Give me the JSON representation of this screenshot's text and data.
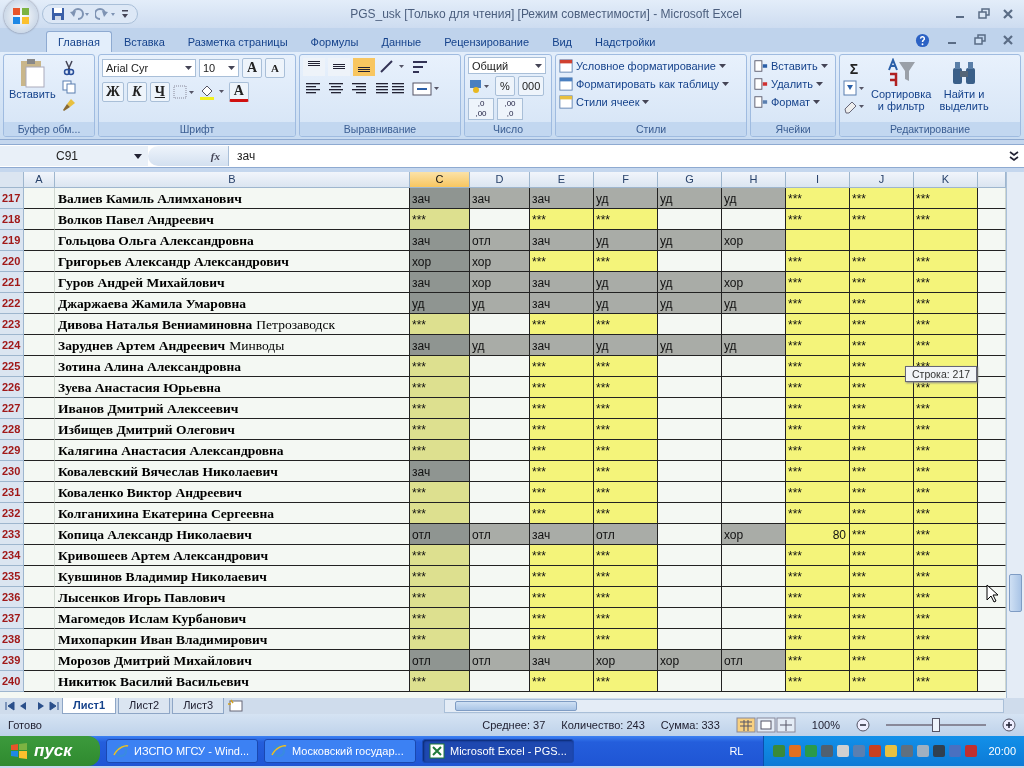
{
  "window": {
    "title": "PGS_usk  [Только для чтения]  [Режим совместимости] - Microsoft Excel"
  },
  "tabs": [
    {
      "label": "Главная",
      "selected": true
    },
    {
      "label": "Вставка",
      "selected": false
    },
    {
      "label": "Разметка страницы",
      "selected": false
    },
    {
      "label": "Формулы",
      "selected": false
    },
    {
      "label": "Данные",
      "selected": false
    },
    {
      "label": "Рецензирование",
      "selected": false
    },
    {
      "label": "Вид",
      "selected": false
    },
    {
      "label": "Надстройки",
      "selected": false
    }
  ],
  "ribbon": {
    "clipboard": {
      "paste": "Вставить",
      "label": "Буфер обм..."
    },
    "font": {
      "family": "Arial Cyr",
      "size": "10",
      "grow": "A",
      "shrink": "A",
      "bold": "Ж",
      "italic": "К",
      "underline": "Ч",
      "color_letter": "А",
      "label": "Шрифт"
    },
    "alignment": {
      "vertical": [
        {
          "selected": false
        },
        {
          "selected": false
        },
        {
          "selected": true
        }
      ],
      "label": "Выравнивание"
    },
    "number": {
      "format": "Общий",
      "percent": "%",
      "thousands": "000",
      "decimals": [
        {
          "top": ",0",
          "bottom": ",00"
        },
        {
          "top": ",00",
          "bottom": ",0"
        }
      ],
      "label": "Число"
    },
    "styles": {
      "items": [
        "Условное форматирование",
        "Форматировать как таблицу",
        "Стили ячеек"
      ],
      "label": "Стили"
    },
    "cells": {
      "items": [
        "Вставить",
        "Удалить",
        "Формат"
      ],
      "label": "Ячейки"
    },
    "editing": {
      "sigma": "Σ",
      "sort": [
        "Сортировка",
        "и фильтр"
      ],
      "find": [
        "Найти и",
        "выделить"
      ],
      "label": "Редактирование"
    }
  },
  "formula_bar": {
    "name_box": "C91",
    "fx": "fx",
    "value": "зач"
  },
  "columns": [
    {
      "label": "A",
      "selected": false
    },
    {
      "label": "B",
      "selected": false
    },
    {
      "label": "C",
      "selected": true,
      "shaded": true
    },
    {
      "label": "D",
      "selected": false,
      "shaded": false
    },
    {
      "label": "E",
      "selected": false,
      "shaded": true
    },
    {
      "label": "F",
      "selected": false,
      "shaded": true
    },
    {
      "label": "G",
      "selected": false,
      "shaded": false
    },
    {
      "label": "H",
      "selected": false,
      "shaded": false
    },
    {
      "label": "I",
      "selected": false,
      "shaded": true
    },
    {
      "label": "J",
      "selected": false,
      "shaded": true
    },
    {
      "label": "K",
      "selected": false,
      "shaded": true
    }
  ],
  "rows": [
    {
      "number": "217",
      "name": "Валиев Камиль Алимханович",
      "cells": [
        {
          "text": "зач",
          "graded": true
        },
        {
          "text": "зач",
          "graded": true
        },
        {
          "text": "зач",
          "graded": true
        },
        {
          "text": "уд",
          "graded": true
        },
        {
          "text": "уд",
          "graded": true
        },
        {
          "text": "уд",
          "graded": true
        },
        {
          "text": "***",
          "graded": false
        },
        {
          "text": "***",
          "graded": false
        },
        {
          "text": "***",
          "graded": false
        }
      ]
    },
    {
      "number": "218",
      "name": "Волков Павел Андреевич",
      "cells": [
        {
          "text": "***",
          "graded": false
        },
        {
          "text": "",
          "graded": false
        },
        {
          "text": "***",
          "graded": false
        },
        {
          "text": "***",
          "graded": false
        },
        {
          "text": "",
          "graded": false
        },
        {
          "text": "",
          "graded": false
        },
        {
          "text": "***",
          "graded": false
        },
        {
          "text": "***",
          "graded": false
        },
        {
          "text": "***",
          "graded": false
        }
      ]
    },
    {
      "number": "219",
      "name": "Гольцова Ольга Александровна",
      "cells": [
        {
          "text": "зач",
          "graded": true
        },
        {
          "text": "отл",
          "graded": true
        },
        {
          "text": "зач",
          "graded": true
        },
        {
          "text": "уд",
          "graded": true
        },
        {
          "text": "уд",
          "graded": true
        },
        {
          "text": "хор",
          "graded": true
        },
        {
          "text": "",
          "graded": false
        },
        {
          "text": "",
          "graded": false
        },
        {
          "text": "",
          "graded": false
        }
      ]
    },
    {
      "number": "220",
      "name": "Григорьев Александр Александрович",
      "cells": [
        {
          "text": "хор",
          "graded": true
        },
        {
          "text": "хор",
          "graded": true
        },
        {
          "text": "***",
          "graded": false
        },
        {
          "text": "***",
          "graded": false
        },
        {
          "text": "",
          "graded": false
        },
        {
          "text": "",
          "graded": false
        },
        {
          "text": "***",
          "graded": false
        },
        {
          "text": "***",
          "graded": false
        },
        {
          "text": "***",
          "graded": false
        }
      ]
    },
    {
      "number": "221",
      "name": "Гуров Андрей Михайлович",
      "cells": [
        {
          "text": "зач",
          "graded": true
        },
        {
          "text": "хор",
          "graded": true
        },
        {
          "text": "зач",
          "graded": true
        },
        {
          "text": "уд",
          "graded": true
        },
        {
          "text": "уд",
          "graded": true
        },
        {
          "text": "хор",
          "graded": true
        },
        {
          "text": "***",
          "graded": false
        },
        {
          "text": "***",
          "graded": false
        },
        {
          "text": "***",
          "graded": false
        }
      ]
    },
    {
      "number": "222",
      "name": "Джаржаева Жамила Умаровна",
      "cells": [
        {
          "text": "уд",
          "graded": true
        },
        {
          "text": "уд",
          "graded": true
        },
        {
          "text": "зач",
          "graded": true
        },
        {
          "text": "уд",
          "graded": true
        },
        {
          "text": "уд",
          "graded": true
        },
        {
          "text": "уд",
          "graded": true
        },
        {
          "text": "***",
          "graded": false
        },
        {
          "text": "***",
          "graded": false
        },
        {
          "text": "***",
          "graded": false
        }
      ]
    },
    {
      "number": "223",
      "name": "Дивова Наталья Вениаминовна",
      "city": "Петрозаводск",
      "cells": [
        {
          "text": "***",
          "graded": false
        },
        {
          "text": "",
          "graded": false
        },
        {
          "text": "***",
          "graded": false
        },
        {
          "text": "***",
          "graded": false
        },
        {
          "text": "",
          "graded": false
        },
        {
          "text": "",
          "graded": false
        },
        {
          "text": "***",
          "graded": false
        },
        {
          "text": "***",
          "graded": false
        },
        {
          "text": "***",
          "graded": false
        }
      ]
    },
    {
      "number": "224",
      "name": "Заруднев Артем Андреевич",
      "city": "Минводы",
      "cells": [
        {
          "text": "зач",
          "graded": true
        },
        {
          "text": "уд",
          "graded": true
        },
        {
          "text": "зач",
          "graded": true
        },
        {
          "text": "уд",
          "graded": true
        },
        {
          "text": "уд",
          "graded": true
        },
        {
          "text": "уд",
          "graded": true
        },
        {
          "text": "***",
          "graded": false
        },
        {
          "text": "***",
          "graded": false
        },
        {
          "text": "***",
          "graded": false
        }
      ]
    },
    {
      "number": "225",
      "name": "Зотина Алина Александровна",
      "cells": [
        {
          "text": "***",
          "graded": false
        },
        {
          "text": "",
          "graded": false
        },
        {
          "text": "***",
          "graded": false
        },
        {
          "text": "***",
          "graded": false
        },
        {
          "text": "",
          "graded": false
        },
        {
          "text": "",
          "graded": false
        },
        {
          "text": "***",
          "graded": false
        },
        {
          "text": "***",
          "graded": false
        },
        {
          "text": "***",
          "graded": false
        }
      ]
    },
    {
      "number": "226",
      "name": "Зуева Анастасия Юрьевна",
      "cells": [
        {
          "text": "***",
          "graded": false
        },
        {
          "text": "",
          "graded": false
        },
        {
          "text": "***",
          "graded": false
        },
        {
          "text": "***",
          "graded": false
        },
        {
          "text": "",
          "graded": false
        },
        {
          "text": "",
          "graded": false
        },
        {
          "text": "***",
          "graded": false
        },
        {
          "text": "***",
          "graded": false
        },
        {
          "text": "***",
          "graded": false
        }
      ]
    },
    {
      "number": "227",
      "name": "Иванов Дмитрий Алексеевич",
      "cells": [
        {
          "text": "***",
          "graded": false
        },
        {
          "text": "",
          "graded": false
        },
        {
          "text": "***",
          "graded": false
        },
        {
          "text": "***",
          "graded": false
        },
        {
          "text": "",
          "graded": false
        },
        {
          "text": "",
          "graded": false
        },
        {
          "text": "***",
          "graded": false
        },
        {
          "text": "***",
          "graded": false
        },
        {
          "text": "***",
          "graded": false
        }
      ]
    },
    {
      "number": "228",
      "name": "Избищев Дмитрий Олегович",
      "cells": [
        {
          "text": "***",
          "graded": false
        },
        {
          "text": "",
          "graded": false
        },
        {
          "text": "***",
          "graded": false
        },
        {
          "text": "***",
          "graded": false
        },
        {
          "text": "",
          "graded": false
        },
        {
          "text": "",
          "graded": false
        },
        {
          "text": "***",
          "graded": false
        },
        {
          "text": "***",
          "graded": false
        },
        {
          "text": "***",
          "graded": false
        }
      ]
    },
    {
      "number": "229",
      "name": "Калягина Анастасия Александровна",
      "cells": [
        {
          "text": "***",
          "graded": false
        },
        {
          "text": "",
          "graded": false
        },
        {
          "text": "***",
          "graded": false
        },
        {
          "text": "***",
          "graded": false
        },
        {
          "text": "",
          "graded": false
        },
        {
          "text": "",
          "graded": false
        },
        {
          "text": "***",
          "graded": false
        },
        {
          "text": "***",
          "graded": false
        },
        {
          "text": "***",
          "graded": false
        }
      ]
    },
    {
      "number": "230",
      "name": "Ковалевский Вячеслав Николаевич",
      "cells": [
        {
          "text": "зач",
          "graded": true
        },
        {
          "text": "",
          "graded": false
        },
        {
          "text": "***",
          "graded": false
        },
        {
          "text": "***",
          "graded": false
        },
        {
          "text": "",
          "graded": false
        },
        {
          "text": "",
          "graded": false
        },
        {
          "text": "***",
          "graded": false
        },
        {
          "text": "***",
          "graded": false
        },
        {
          "text": "***",
          "graded": false
        }
      ]
    },
    {
      "number": "231",
      "name": "Коваленко Виктор Андреевич",
      "cells": [
        {
          "text": "***",
          "graded": false
        },
        {
          "text": "",
          "graded": false
        },
        {
          "text": "***",
          "graded": false
        },
        {
          "text": "***",
          "graded": false
        },
        {
          "text": "",
          "graded": false
        },
        {
          "text": "",
          "graded": false
        },
        {
          "text": "***",
          "graded": false
        },
        {
          "text": "***",
          "graded": false
        },
        {
          "text": "***",
          "graded": false
        }
      ]
    },
    {
      "number": "232",
      "name": "Колганихина Екатерина Сергеевна",
      "cells": [
        {
          "text": "***",
          "graded": false
        },
        {
          "text": "",
          "graded": false
        },
        {
          "text": "***",
          "graded": false
        },
        {
          "text": "***",
          "graded": false
        },
        {
          "text": "",
          "graded": false
        },
        {
          "text": "",
          "graded": false
        },
        {
          "text": "***",
          "graded": false
        },
        {
          "text": "***",
          "graded": false
        },
        {
          "text": "***",
          "graded": false
        }
      ]
    },
    {
      "number": "233",
      "name": "Копица Александр Николаевич",
      "cells": [
        {
          "text": "отл",
          "graded": true
        },
        {
          "text": "отл",
          "graded": true
        },
        {
          "text": "зач",
          "graded": true
        },
        {
          "text": "отл",
          "graded": true
        },
        {
          "text": "",
          "graded": false
        },
        {
          "text": "хор",
          "graded": true
        },
        {
          "text": "80",
          "graded": false,
          "numeric": true
        },
        {
          "text": "***",
          "graded": false
        },
        {
          "text": "***",
          "graded": false
        }
      ]
    },
    {
      "number": "234",
      "name": "Кривошеев Артем Александрович",
      "cells": [
        {
          "text": "***",
          "graded": false
        },
        {
          "text": "",
          "graded": false
        },
        {
          "text": "***",
          "graded": false
        },
        {
          "text": "***",
          "graded": false
        },
        {
          "text": "",
          "graded": false
        },
        {
          "text": "",
          "graded": false
        },
        {
          "text": "***",
          "graded": false
        },
        {
          "text": "***",
          "graded": false
        },
        {
          "text": "***",
          "graded": false
        }
      ]
    },
    {
      "number": "235",
      "name": "Кувшинов Владимир Николаевич",
      "cells": [
        {
          "text": "***",
          "graded": false
        },
        {
          "text": "",
          "graded": false
        },
        {
          "text": "***",
          "graded": false
        },
        {
          "text": "***",
          "graded": false
        },
        {
          "text": "",
          "graded": false
        },
        {
          "text": "",
          "graded": false
        },
        {
          "text": "***",
          "graded": false
        },
        {
          "text": "***",
          "graded": false
        },
        {
          "text": "***",
          "graded": false
        }
      ]
    },
    {
      "number": "236",
      "name": "Лысенков Игорь Павлович",
      "cells": [
        {
          "text": "***",
          "graded": false
        },
        {
          "text": "",
          "graded": false
        },
        {
          "text": "***",
          "graded": false
        },
        {
          "text": "***",
          "graded": false
        },
        {
          "text": "",
          "graded": false
        },
        {
          "text": "",
          "graded": false
        },
        {
          "text": "***",
          "graded": false
        },
        {
          "text": "***",
          "graded": false
        },
        {
          "text": "***",
          "graded": false
        }
      ]
    },
    {
      "number": "237",
      "name": "Магомедов Ислам Курбанович",
      "cells": [
        {
          "text": "***",
          "graded": false
        },
        {
          "text": "",
          "graded": false
        },
        {
          "text": "***",
          "graded": false
        },
        {
          "text": "***",
          "graded": false
        },
        {
          "text": "",
          "graded": false
        },
        {
          "text": "",
          "graded": false
        },
        {
          "text": "***",
          "graded": false
        },
        {
          "text": "***",
          "graded": false
        },
        {
          "text": "***",
          "graded": false
        }
      ]
    },
    {
      "number": "238",
      "name": "Михопаркин Иван Владимирович",
      "cells": [
        {
          "text": "***",
          "graded": false
        },
        {
          "text": "",
          "graded": false
        },
        {
          "text": "***",
          "graded": false
        },
        {
          "text": "***",
          "graded": false
        },
        {
          "text": "",
          "graded": false
        },
        {
          "text": "",
          "graded": false
        },
        {
          "text": "***",
          "graded": false
        },
        {
          "text": "***",
          "graded": false
        },
        {
          "text": "***",
          "graded": false
        }
      ]
    },
    {
      "number": "239",
      "name": "Морозов Дмитрий Михайлович",
      "cells": [
        {
          "text": "отл",
          "graded": true
        },
        {
          "text": "отл",
          "graded": true
        },
        {
          "text": "зач",
          "graded": true
        },
        {
          "text": "хор",
          "graded": true
        },
        {
          "text": "хор",
          "graded": true
        },
        {
          "text": "отл",
          "graded": true
        },
        {
          "text": "***",
          "graded": false
        },
        {
          "text": "***",
          "graded": false
        },
        {
          "text": "***",
          "graded": false
        }
      ]
    },
    {
      "number": "240",
      "name": "Никитюк Василий Васильевич",
      "cells": [
        {
          "text": "***",
          "graded": false
        },
        {
          "text": "",
          "graded": false
        },
        {
          "text": "***",
          "graded": false
        },
        {
          "text": "***",
          "graded": false
        },
        {
          "text": "",
          "graded": false
        },
        {
          "text": "",
          "graded": false
        },
        {
          "text": "***",
          "graded": false
        },
        {
          "text": "***",
          "graded": false
        },
        {
          "text": "***",
          "graded": false
        }
      ]
    }
  ],
  "tooltip": "Строка: 217",
  "sheets": [
    {
      "label": "Лист1",
      "selected": true
    },
    {
      "label": "Лист2",
      "selected": false
    },
    {
      "label": "Лист3",
      "selected": false
    }
  ],
  "status_bar": {
    "ready": "Готово",
    "average": "Среднее: 37",
    "count": "Количество: 243",
    "sum": "Сумма: 333",
    "zoom": "100%",
    "zoom_slider": {
      "level": 0.5
    }
  },
  "taskbar": {
    "start": "пуск",
    "tasks": [
      {
        "label": "ИЗСПО МГСУ - Wind...",
        "kind": "browser",
        "selected": false
      },
      {
        "label": "Московский государ...",
        "kind": "browser",
        "selected": false
      },
      {
        "label": "Microsoft Excel - PGS...",
        "kind": "excel",
        "selected": true
      }
    ],
    "language": "RL",
    "clock": "20:00"
  }
}
